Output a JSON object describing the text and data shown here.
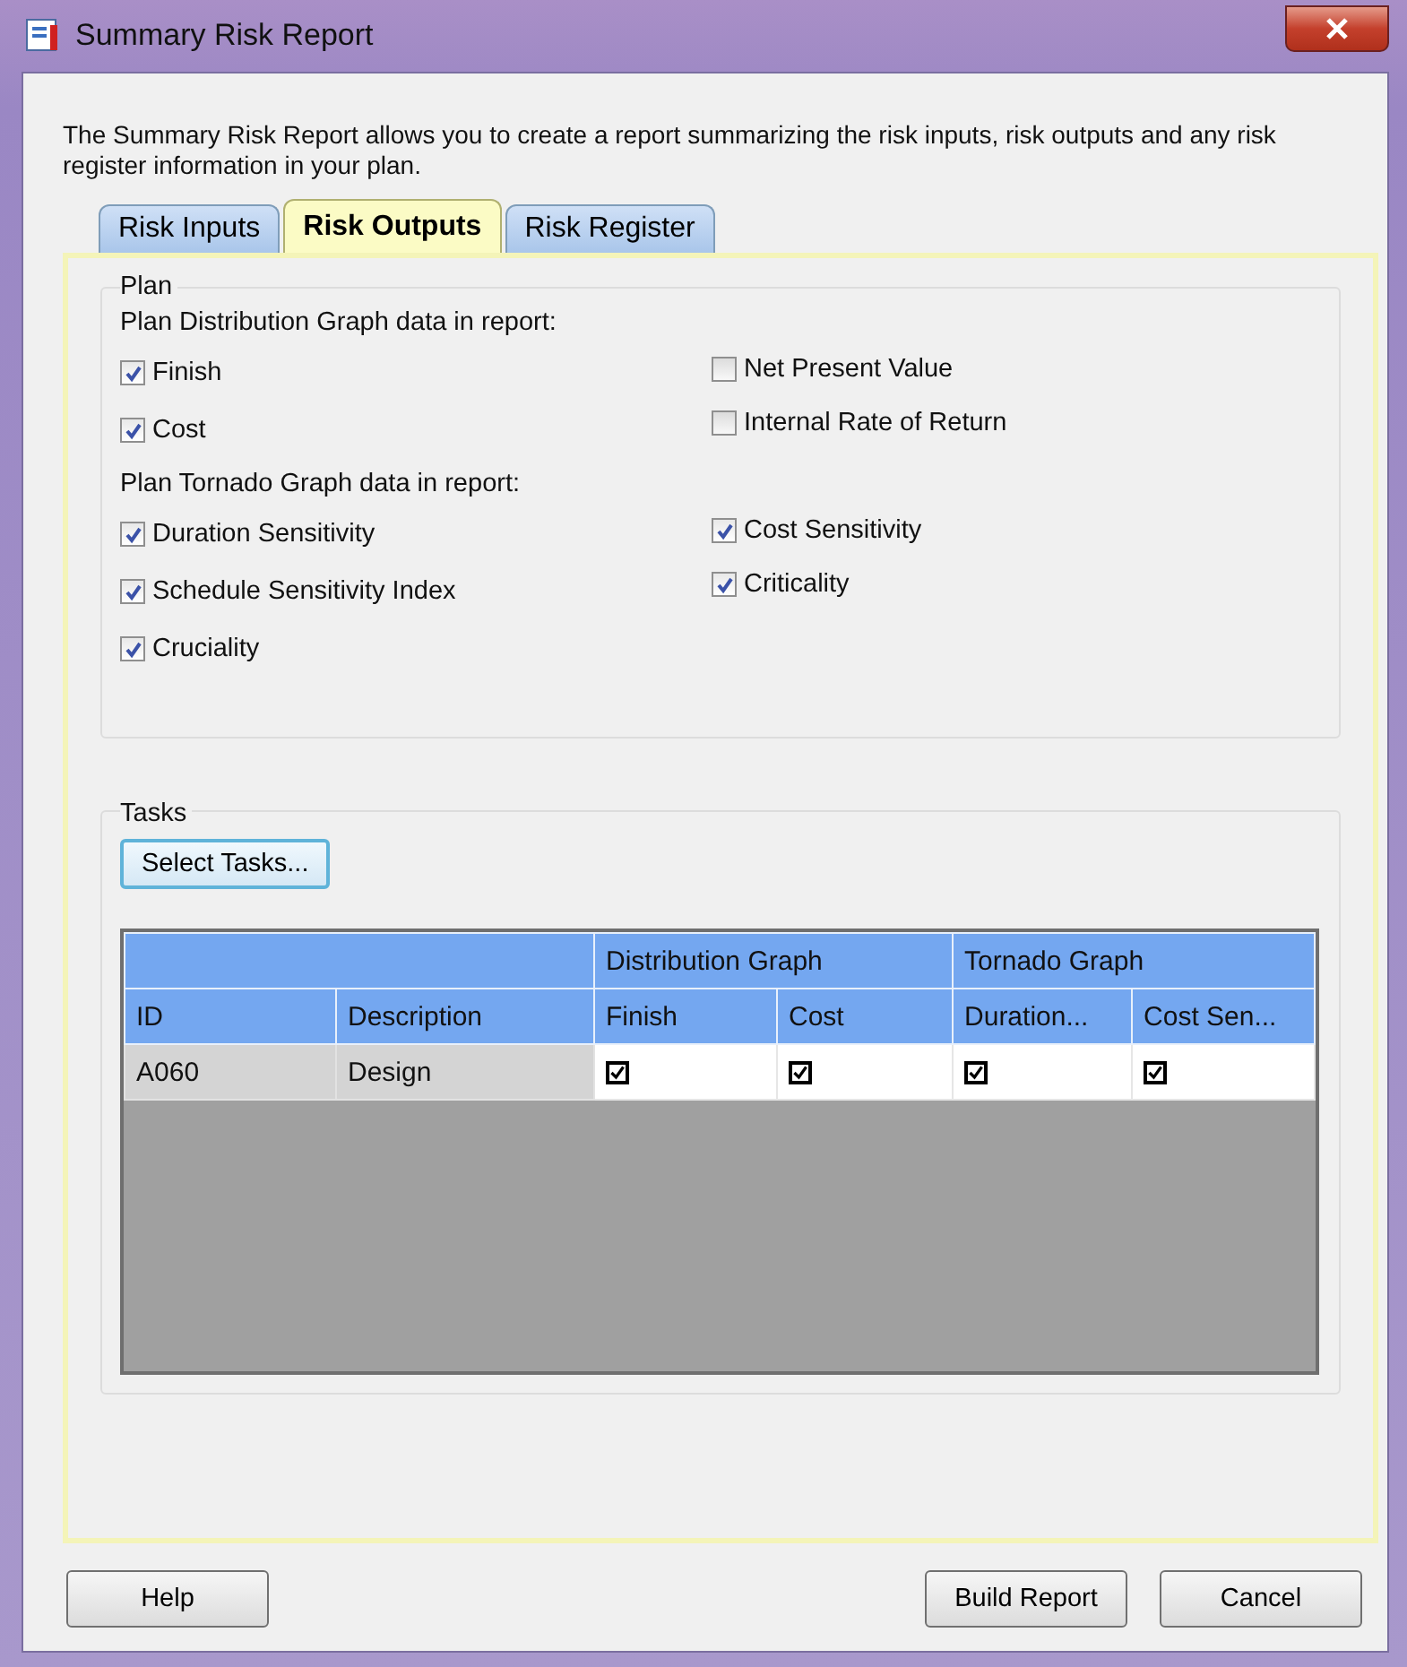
{
  "window": {
    "title": "Summary Risk Report"
  },
  "intro": "The Summary Risk Report allows you to create a report summarizing the risk inputs, risk outputs and any risk register information in your plan.",
  "tabs": [
    {
      "label": "Risk Inputs",
      "selected": false
    },
    {
      "label": "Risk Outputs",
      "selected": true
    },
    {
      "label": "Risk Register",
      "selected": false
    }
  ],
  "plan": {
    "title": "Plan",
    "sections": [
      {
        "heading": "Plan Distribution Graph data in report:",
        "columns": [
          [
            {
              "label": "Finish",
              "checked": true
            },
            {
              "label": "Cost",
              "checked": true
            }
          ],
          [
            {
              "label": "Net Present Value",
              "checked": false
            },
            {
              "label": "Internal Rate of Return",
              "checked": false
            }
          ]
        ]
      },
      {
        "heading": "Plan Tornado Graph data in report:",
        "columns": [
          [
            {
              "label": "Duration Sensitivity",
              "checked": true
            },
            {
              "label": "Schedule Sensitivity Index",
              "checked": true
            },
            {
              "label": "Cruciality",
              "checked": true
            }
          ],
          [
            {
              "label": "Cost Sensitivity",
              "checked": true
            },
            {
              "label": "Criticality",
              "checked": true
            }
          ]
        ]
      }
    ]
  },
  "tasks": {
    "title": "Tasks",
    "select_button": "Select Tasks...",
    "table": {
      "groups": [
        {
          "label": "Distribution Graph"
        },
        {
          "label": "Tornado Graph"
        }
      ],
      "columns": [
        "ID",
        "Description",
        "Finish",
        "Cost",
        "Duration...",
        "Cost Sen..."
      ],
      "rows": [
        {
          "id": "A060",
          "description": "Design",
          "checks": [
            true,
            true,
            true,
            true
          ]
        }
      ]
    }
  },
  "buttons": {
    "help": "Help",
    "build": "Build Report",
    "cancel": "Cancel"
  }
}
